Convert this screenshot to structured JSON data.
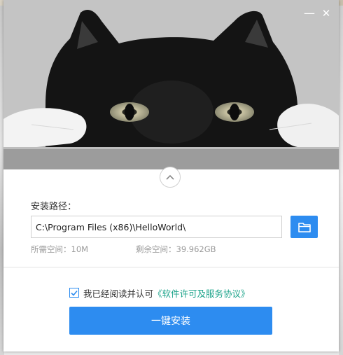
{
  "window": {
    "minimize_glyph": "—",
    "close_glyph": "✕"
  },
  "install": {
    "path_label": "安装路径：",
    "path_value": "C:\\Program Files (x86)\\HelloWorld\\",
    "space_required": "所需空间：10M",
    "space_free": "剩余空间：39.962GB",
    "agree_text": "我已经阅读并认可",
    "license_link": "《软件许可及服务协议》",
    "install_button": "一键安装"
  },
  "colors": {
    "accent": "#2d8cf0",
    "link": "#1ba38a"
  },
  "icons": [
    "cat-banner-image",
    "minimize-icon",
    "close-icon",
    "chevron-up-icon",
    "folder-icon",
    "checkmark-icon"
  ]
}
